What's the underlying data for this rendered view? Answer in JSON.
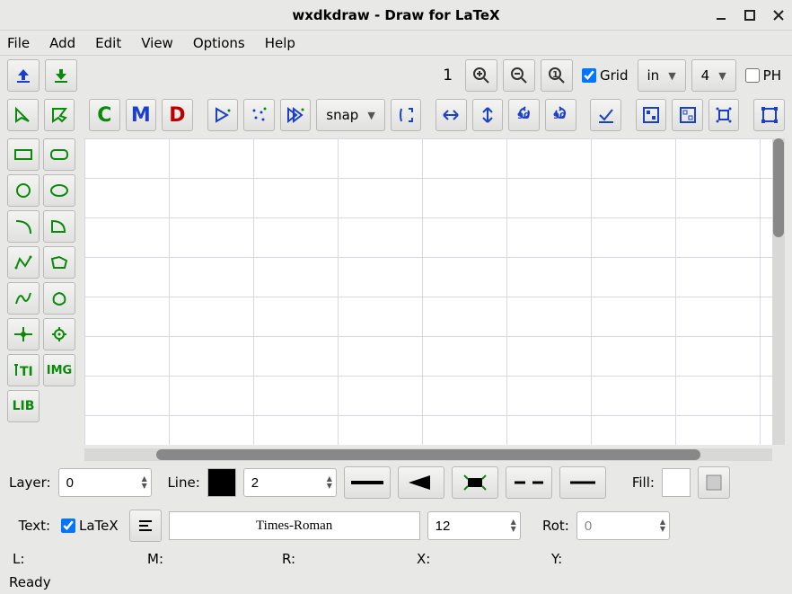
{
  "window": {
    "title": "wxdkdraw - Draw for LaTeX"
  },
  "menu": {
    "file": "File",
    "add": "Add",
    "edit": "Edit",
    "view": "View",
    "options": "Options",
    "help": "Help"
  },
  "toolbar": {
    "zoom_value": "1",
    "grid_checkbox": "Grid",
    "grid_checked": true,
    "unit": "in",
    "subdivisions": "4",
    "ph_checkbox": "PH",
    "ph_checked": false,
    "snap_label": "snap"
  },
  "properties": {
    "layer_label": "Layer:",
    "layer_value": "0",
    "line_label": "Line:",
    "line_width_value": "2",
    "fill_label": "Fill:",
    "text_label": "Text:",
    "latex_checkbox": "LaTeX",
    "latex_checked": true,
    "font_name": "Times-Roman",
    "font_size": "12",
    "rot_label": "Rot:",
    "rot_value": "0"
  },
  "status": {
    "l": "L:",
    "m": "M:",
    "r": "R:",
    "x": "X:",
    "y": "Y:",
    "ready": "Ready"
  }
}
